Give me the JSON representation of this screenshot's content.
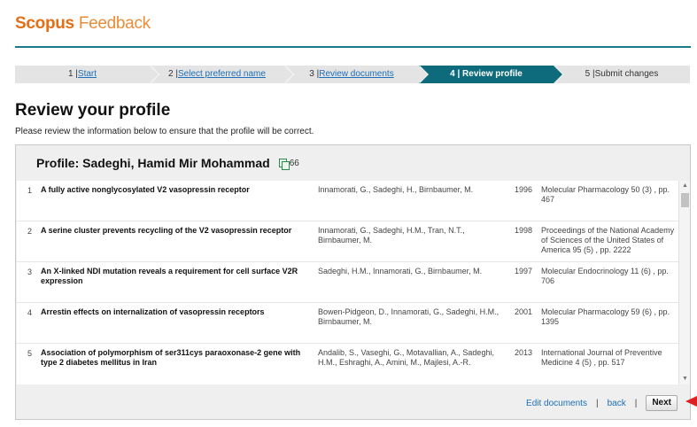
{
  "header": {
    "brand_scopus": "Scopus",
    "brand_feedback": "Feedback"
  },
  "steps": [
    {
      "num": "1 |",
      "label": "Start"
    },
    {
      "num": "2 |",
      "label": "Select preferred name"
    },
    {
      "num": "3 |",
      "label": "Review documents"
    },
    {
      "num": "4 |",
      "label": "Review profile"
    },
    {
      "num": "5 |",
      "label": "Submit changes"
    }
  ],
  "page": {
    "title": "Review your profile",
    "intro": "Please review the information below to ensure that the profile will be correct."
  },
  "profile": {
    "heading": "Profile: Sadeghi, Hamid Mir Mohammad",
    "doc_count": "66"
  },
  "documents": [
    {
      "n": "1",
      "title": "A fully active nonglycosylated V2 vasopressin receptor",
      "authors": "Innamorati, G., Sadeghi, H., Birnbaumer, M.",
      "year": "1996",
      "source": "Molecular Pharmacology 50 (3) , pp. 467"
    },
    {
      "n": "2",
      "title": "A serine cluster prevents recycling of the V2 vasopressin receptor",
      "authors": "Innamorati, G., Sadeghi, H.M., Tran, N.T., Birnbaumer, M.",
      "year": "1998",
      "source": "Proceedings of the National Academy of Sciences of the United States of America 95 (5) , pp. 2222"
    },
    {
      "n": "3",
      "title": "An X-linked NDI mutation reveals a requirement for cell surface V2R expression",
      "authors": "Sadeghi, H.M., Innamorati, G., Birnbaumer, M.",
      "year": "1997",
      "source": "Molecular Endocrinology 11 (6) , pp. 706"
    },
    {
      "n": "4",
      "title": "Arrestin effects on internalization of vasopressin receptors",
      "authors": "Bowen-Pidgeon, D., Innamorati, G., Sadeghi, H.M., Birnbaumer, M.",
      "year": "2001",
      "source": "Molecular Pharmacology 59 (6) , pp. 1395"
    },
    {
      "n": "5",
      "title": "Association of polymorphism of ser311cys paraoxonase-2 gene with type 2 diabetes mellitus in Iran",
      "authors": "Andalib, S., Vaseghi, G., Motavallian, A., Sadeghi, H.M., Eshraghi, A., Amini, M., Majlesi, A.-R.",
      "year": "2013",
      "source": "International Journal of Preventive Medicine 4 (5) , pp. 517"
    }
  ],
  "footer": {
    "edit_documents": "Edit documents",
    "sep": "|",
    "back": "back",
    "next": "Next"
  },
  "icons": {
    "doc_count": "documents-icon",
    "scroll_up": "scroll-up-arrow-icon",
    "scroll_down": "scroll-down-arrow-icon",
    "pointer": "red-pointer-icon"
  }
}
